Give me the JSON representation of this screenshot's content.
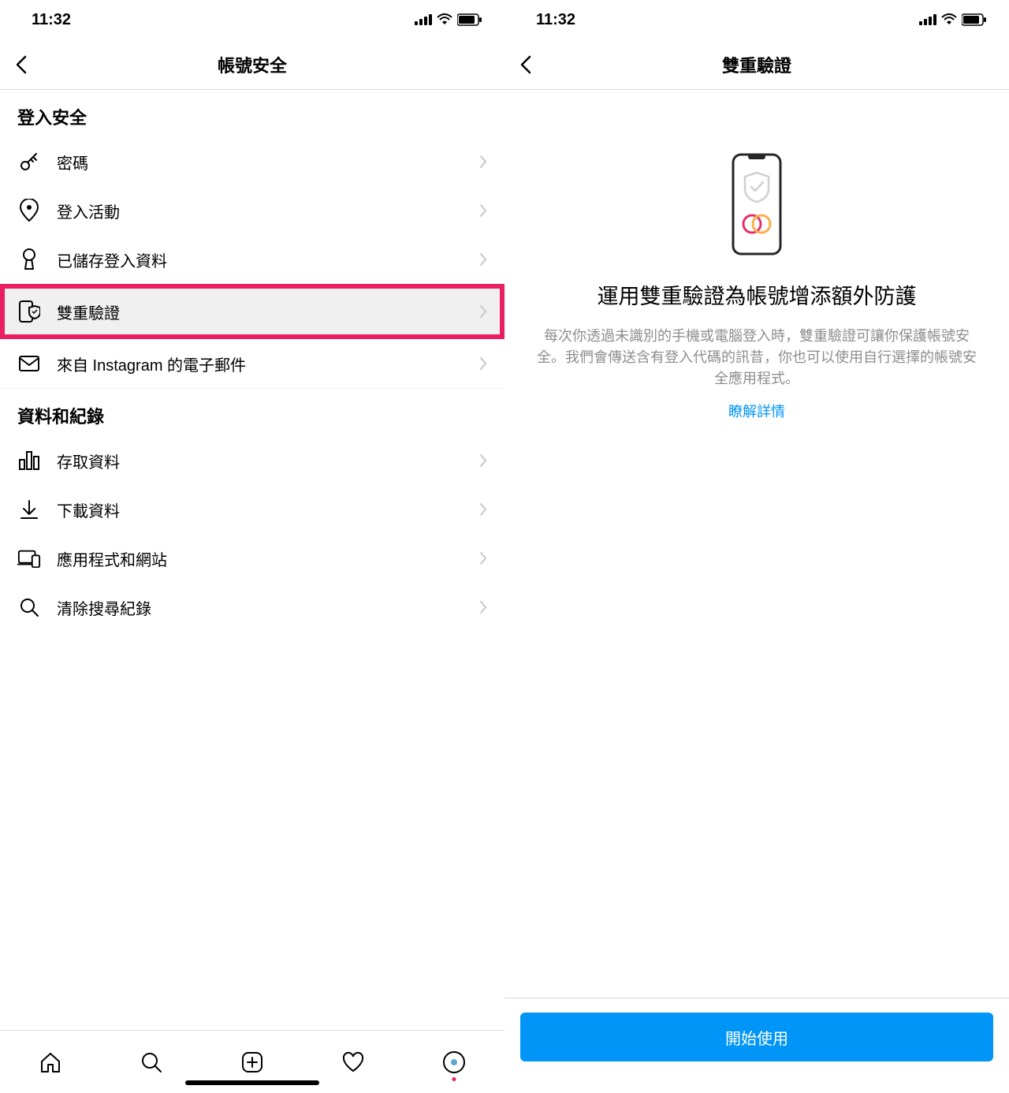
{
  "status": {
    "time": "11:32"
  },
  "screen1": {
    "title": "帳號安全",
    "sections": [
      {
        "header": "登入安全",
        "items": [
          {
            "label": "密碼",
            "icon": "key-icon"
          },
          {
            "label": "登入活動",
            "icon": "location-pin-icon"
          },
          {
            "label": "已儲存登入資料",
            "icon": "keyhole-icon"
          },
          {
            "label": "雙重驗證",
            "icon": "phone-shield-icon",
            "highlighted": true
          },
          {
            "label": "來自 Instagram 的電子郵件",
            "icon": "mail-icon"
          }
        ]
      },
      {
        "header": "資料和紀錄",
        "items": [
          {
            "label": "存取資料",
            "icon": "bar-chart-icon"
          },
          {
            "label": "下載資料",
            "icon": "download-icon"
          },
          {
            "label": "應用程式和網站",
            "icon": "devices-icon"
          },
          {
            "label": "清除搜尋紀錄",
            "icon": "search-icon"
          }
        ]
      }
    ]
  },
  "screen2": {
    "title": "雙重驗證",
    "heading": "運用雙重驗證為帳號增添額外防護",
    "description": "每次你透過未識別的手機或電腦登入時，雙重驗證可讓你保護帳號安全。我們會傳送含有登入代碼的訊昔，你也可以使用自行選擇的帳號安全應用程式。",
    "link_label": "瞭解詳情",
    "button_label": "開始使用"
  }
}
